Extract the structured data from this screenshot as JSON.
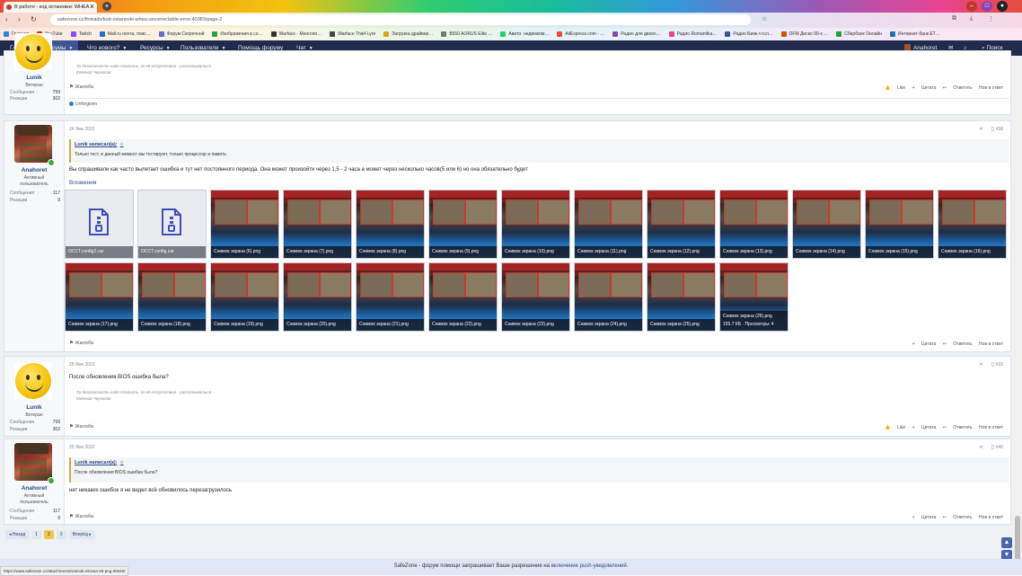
{
  "browser": {
    "tab_title": "В работе - код остановки: WHEA…",
    "url": "safezone.cc/threads/kod-ostanovki-whea-uncorrectable-error.40383/page-2",
    "bookmarks": [
      {
        "label": "Главная",
        "color": "#2e86de"
      },
      {
        "label": "YouTube",
        "color": "#e62117"
      },
      {
        "label": "Twitch",
        "color": "#9146ff"
      },
      {
        "label": "Mail.ru почта, поис…",
        "color": "#2b6ad8"
      },
      {
        "label": "Форум Скорочной",
        "color": "#5f6bd5"
      },
      {
        "label": "Изображения в со…",
        "color": "#2f9e44"
      },
      {
        "label": "Warface - Многопо…",
        "color": "#333333"
      },
      {
        "label": "Warface Thief-Lyre",
        "color": "#444444"
      },
      {
        "label": "Загрузка драйвер…",
        "color": "#e7a019"
      },
      {
        "label": "B550 AORUS Elite …",
        "color": "#777777"
      },
      {
        "label": "Авито: недвижим…",
        "color": "#2ecc71"
      },
      {
        "label": "AliExpress.com - …",
        "color": "#e74c3c"
      },
      {
        "label": "Радио для двоих…",
        "color": "#8e44ad"
      },
      {
        "label": "Радио Romantika…",
        "color": "#e84393"
      },
      {
        "label": "Радио Бияк <<сл…",
        "color": "#3d5595"
      },
      {
        "label": "DFM Диско 90-х …",
        "color": "#d35400"
      },
      {
        "label": "Сбербанк Онлайн",
        "color": "#21a038"
      },
      {
        "label": "Интернет-банк ЕТ…",
        "color": "#1f6fb8"
      }
    ]
  },
  "nav": {
    "home": "Главная",
    "forums": "Форумы",
    "whats_new": "Что нового?",
    "resources": "Ресурсы",
    "members": "Пользователи",
    "help": "Помощь форуму",
    "chat": "Чат",
    "username": "Anahoret",
    "search": "Поиск"
  },
  "posts": {
    "p1": {
      "user": "Lunik",
      "title": "Ветеран",
      "messages_label": "Сообщения",
      "messages": "799",
      "reactions_label": "Реакции",
      "reactions": "302",
      "sig1": "За безопасность надо платить, за её отсутствие - расплачиваться",
      "sig2": "Евгений Черкасов",
      "report": "Жалоба",
      "like": "Like",
      "quote": "Цитата",
      "reply": "Ответить",
      "new_topic": "Нов в ответ",
      "reaction_user": "Unforgiven"
    },
    "p2": {
      "user": "Anahoret",
      "title": "Активный пользователь",
      "messages_label": "Сообщения",
      "messages": "117",
      "reactions_label": "Реакции",
      "reactions": "9",
      "date": "24 Янв 2022",
      "num": "#38",
      "quote_head": "Lunik написал(а):",
      "quote_text": "Только тест, в данный момент мы тестируют, только процессор и память",
      "body": "Вы спрашивали как часто вылетает ошибка и тут нет постоянного периода. Она может произойти через 1,5 - 2 часа а может через несколько часов(5 или 6) но она обязательно будет",
      "attachments_label": "Вложения",
      "attachments": [
        {
          "name": "OCCT.config2.car",
          "kind": "file"
        },
        {
          "name": "OCCT.config.car",
          "kind": "file"
        },
        {
          "name": "Снимок экрана (6).png",
          "kind": "shot"
        },
        {
          "name": "Снимок экрана (7).png",
          "kind": "shot"
        },
        {
          "name": "Снимок экрана (8).png",
          "kind": "shot"
        },
        {
          "name": "Снимок экрана (9).png",
          "kind": "shot"
        },
        {
          "name": "Снимок экрана (10).png",
          "kind": "shot"
        },
        {
          "name": "Снимок экрана (11).png",
          "kind": "shot"
        },
        {
          "name": "Снимок экрана (12).png",
          "kind": "shot"
        },
        {
          "name": "Снимок экрана (13).png",
          "kind": "shot"
        },
        {
          "name": "Снимок экрана (14).png",
          "kind": "shot"
        },
        {
          "name": "Снимок экрана (15).png",
          "kind": "shot"
        },
        {
          "name": "Снимок экрана (16).png",
          "kind": "shot"
        },
        {
          "name": "Снимок экрана (17).png",
          "kind": "shot"
        },
        {
          "name": "Снимок экрана (18).png",
          "kind": "shot"
        },
        {
          "name": "Снимок экрана (19).png",
          "kind": "shot"
        },
        {
          "name": "Снимок экрана (20).png",
          "kind": "shot"
        },
        {
          "name": "Снимок экрана (21).png",
          "kind": "shot"
        },
        {
          "name": "Снимок экрана (22).png",
          "kind": "shot"
        },
        {
          "name": "Снимок экрана (23).png",
          "kind": "shot"
        },
        {
          "name": "Снимок экрана (24).png",
          "kind": "shot"
        },
        {
          "name": "Снимок экрана (25).png",
          "kind": "shot"
        },
        {
          "name": "Снимок экрана (26).png",
          "kind": "shot",
          "meta": "155.7 КБ · Просмотры: 4"
        }
      ],
      "report": "Жалоба",
      "quote": "Цитата",
      "reply": "Ответить",
      "new_topic": "Нов в ответ"
    },
    "p3": {
      "user": "Lunik",
      "title": "Ветеран",
      "messages_label": "Сообщения",
      "messages": "799",
      "reactions_label": "Реакции",
      "reactions": "302",
      "date": "25 Янв 2022",
      "num": "#39",
      "body": "После обновления BIOS ошибка была?",
      "sig1": "За безопасность надо платить, за её отсутствие - расплачиваться",
      "sig2": "Евгений Черкасов",
      "report": "Жалоба",
      "like": "Like",
      "quote": "Цитата",
      "reply": "Ответить",
      "new_topic": "Нов в ответ"
    },
    "p4": {
      "user": "Anahoret",
      "title": "Активный пользователь",
      "messages_label": "Сообщения",
      "messages": "117",
      "reactions_label": "Реакции",
      "reactions": "9",
      "date": "25 Янв 2022",
      "num": "#40",
      "quote_head": "Lunik написал(а):",
      "quote_text": "После обновления BIOS ошибка была?",
      "body": "нет никаких ошибок я не видел всё обновилось перезагрузилось",
      "report": "Жалоба",
      "quote": "Цитата",
      "reply": "Ответить",
      "new_topic": "Нов в ответ"
    }
  },
  "pager": {
    "prev": "◂ Назад",
    "pages": [
      "1",
      "2",
      "3"
    ],
    "current": "2",
    "next": "Вперёд ▸"
  },
  "status_url": "https://www.safezone.cc/attachments/snimok-ekrana-26-png.80646/",
  "push": {
    "text": "SafeZone - форум помощи запрашивает Ваше разрешение на",
    "link": "включение push-уведомлений."
  }
}
